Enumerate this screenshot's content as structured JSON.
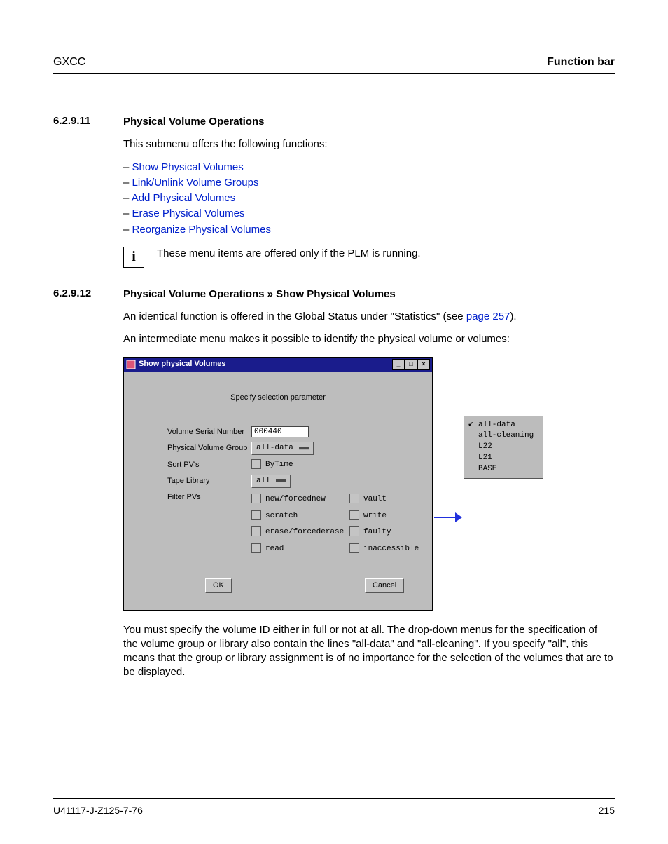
{
  "header": {
    "left": "GXCC",
    "right": "Function bar"
  },
  "s1": {
    "num": "6.2.9.11",
    "title": "Physical Volume Operations",
    "intro": "This submenu offers the following functions:",
    "links": [
      "Show Physical Volumes",
      "Link/Unlink Volume Groups",
      "Add Physical Volumes",
      "Erase Physical Volumes",
      "Reorganize Physical Volumes"
    ],
    "note": "These menu items are offered only if the PLM is running."
  },
  "s2": {
    "num": "6.2.9.12",
    "title": "Physical Volume Operations » Show Physical Volumes",
    "p1a": "An identical function is offered in the Global Status under \"Statistics\" (see ",
    "p1link": "page 257",
    "p1b": ").",
    "p2": "An intermediate menu makes it possible to identify the physical volume or volumes:",
    "p3": "You must specify the volume ID either in full or not at all. The drop-down menus for the specification of the volume group or library also contain the lines \"all-data\" and \"all-cleaning\". If you specify \"all\", this means that the group or library assignment is of no importance for the selection of the volumes that are to be displayed."
  },
  "dialog": {
    "title": "Show physical Volumes",
    "spec": "Specify selection parameter",
    "labels": {
      "vsn": "Volume Serial Number",
      "pvg": "Physical Volume Group",
      "sort": "Sort PV's",
      "lib": "Tape Library",
      "filter": "Filter PVs"
    },
    "vsn_value": "000440",
    "pvg_value": "all-data",
    "sort_value": "ByTime",
    "lib_value": "all",
    "filters": {
      "c1": [
        "new/forcednew",
        "scratch",
        "erase/forcederase",
        "read"
      ],
      "c2": [
        "vault",
        "write",
        "faulty",
        "inaccessible"
      ]
    },
    "ok": "OK",
    "cancel": "Cancel"
  },
  "popup": {
    "items": [
      "all-data",
      "all-cleaning",
      "L22",
      "L21",
      "BASE"
    ]
  },
  "footer": {
    "left": "U41117-J-Z125-7-76",
    "right": "215"
  }
}
